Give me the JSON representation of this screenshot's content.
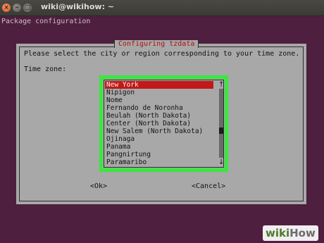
{
  "window": {
    "title": "wiki@wikihow: ~",
    "close_glyph": "×",
    "min_glyph": "–",
    "max_glyph": "□"
  },
  "terminal": {
    "header": "Package configuration"
  },
  "dialog": {
    "title": "Configuring tzdata",
    "prompt": "Please select the city or region corresponding to your time zone.",
    "field_label": "Time zone:",
    "options": [
      {
        "label": "New York",
        "selected": true
      },
      {
        "label": "Nipigon",
        "selected": false
      },
      {
        "label": "Nome",
        "selected": false
      },
      {
        "label": "Fernando de Noronha",
        "selected": false
      },
      {
        "label": "Beulah (North Dakota)",
        "selected": false
      },
      {
        "label": "Center (North Dakota)",
        "selected": false
      },
      {
        "label": "New Salem (North Dakota)",
        "selected": false
      },
      {
        "label": "Ojinaga",
        "selected": false
      },
      {
        "label": "Panama",
        "selected": false
      },
      {
        "label": "Pangnirtung",
        "selected": false
      },
      {
        "label": "Paramaribo",
        "selected": false
      }
    ],
    "scroll_up_glyph": "↑",
    "scroll_down_glyph": "↓",
    "ok_label": "<Ok>",
    "cancel_label": "<Cancel>"
  },
  "watermark": {
    "part1": "wiki",
    "part2": "How"
  },
  "colors": {
    "terminal_background": "#4e1f3e",
    "dialog_background": "#a8a8a8",
    "dialog_title_text": "#b01010",
    "selection_background": "#c21818",
    "highlight_border": "#39e83c"
  }
}
